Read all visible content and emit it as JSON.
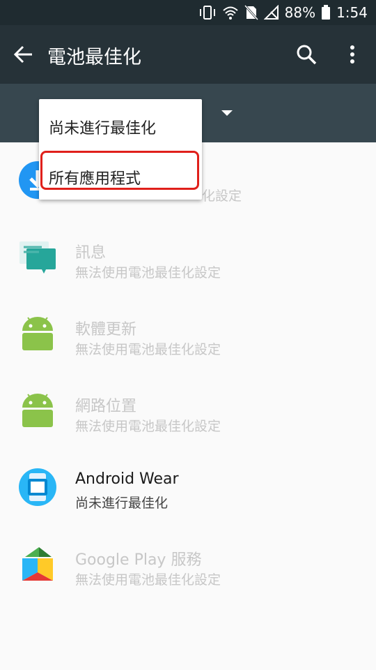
{
  "status_bar": {
    "battery": "88%",
    "time": "1:54",
    "icons": [
      "vibrate-icon",
      "wifi-icon",
      "no-sim-icon",
      "no-signal-icon",
      "battery-icon"
    ]
  },
  "app_bar": {
    "title": "電池最佳化",
    "icons": [
      "back-arrow-icon",
      "search-icon",
      "more-vert-icon"
    ]
  },
  "dropdown": {
    "options": [
      "尚未進行最佳化",
      "所有應用程式"
    ],
    "highlighted_index": 1
  },
  "apps": [
    {
      "name": "",
      "status": "化設定",
      "icon": "download-app-icon",
      "enabled": false
    },
    {
      "name": "訊息",
      "status": "無法使用電池最佳化設定",
      "icon": "messages-icon",
      "enabled": false
    },
    {
      "name": "軟體更新",
      "status": "無法使用電池最佳化設定",
      "icon": "android-icon",
      "enabled": false
    },
    {
      "name": "網路位置",
      "status": "無法使用電池最佳化設定",
      "icon": "android-icon",
      "enabled": false
    },
    {
      "name": "Android Wear",
      "status": "尚未進行最佳化",
      "icon": "android-wear-icon",
      "enabled": true
    },
    {
      "name": "Google Play 服務",
      "status": "無法使用電池最佳化設定",
      "icon": "google-play-services-icon",
      "enabled": false
    }
  ],
  "colors": {
    "status_bar": "#1f2b30",
    "app_bar": "#263238",
    "filter_bar": "#37474f",
    "highlight": "#e0201b"
  }
}
